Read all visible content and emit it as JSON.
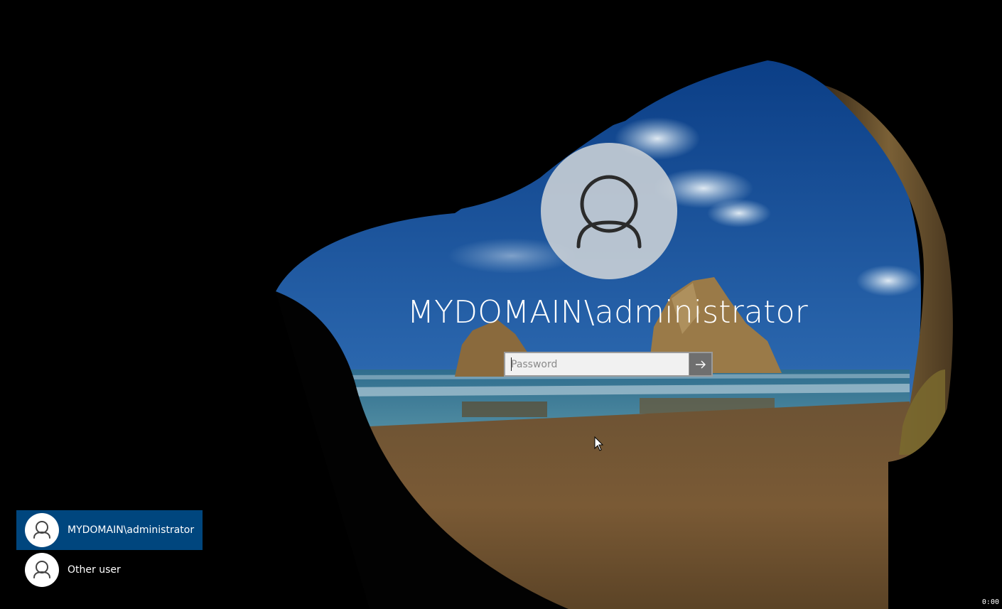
{
  "lock_screen": {
    "username": "MYDOMAIN\\administrator",
    "password_placeholder": "Password",
    "password_value": ""
  },
  "user_list": [
    {
      "label": "MYDOMAIN\\administrator",
      "selected": true
    },
    {
      "label": "Other user",
      "selected": false
    }
  ],
  "icons": {
    "avatar": "user-silhouette-icon",
    "submit": "arrow-right-icon",
    "pointer": "mouse-cursor-icon"
  },
  "clock_text": "0:00",
  "colors": {
    "selected_tile": "#00467e",
    "submit_button": "#6f6f6f",
    "input_background": "#f1f1f1"
  }
}
